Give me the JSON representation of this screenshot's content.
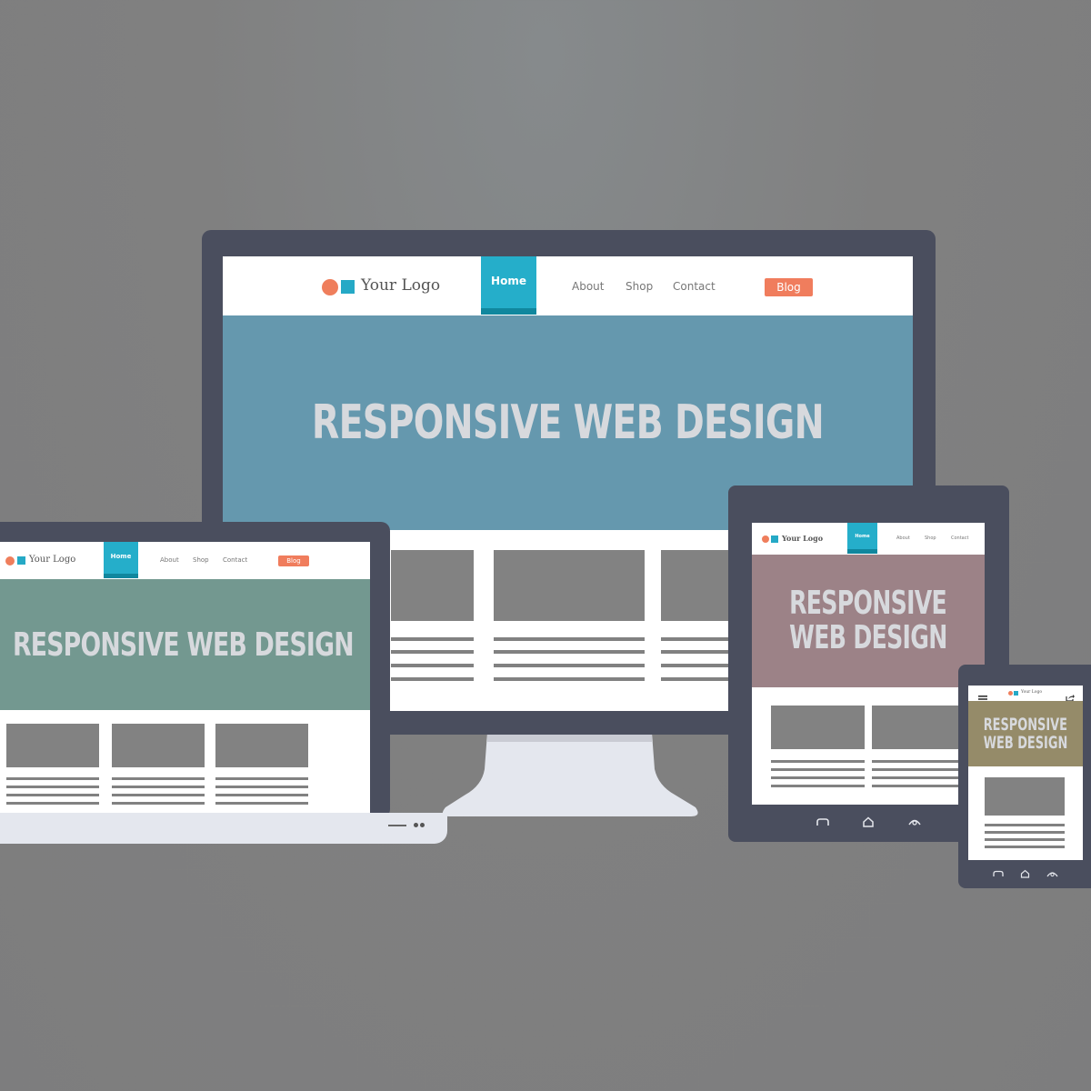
{
  "colors": {
    "bezel": "#4a4e5e",
    "accent_home": "#25aeca",
    "blog_button": "#f07d5d",
    "desktop_hero": "#6598ae",
    "laptop_hero": "#739890",
    "tablet_hero": "#9c8287",
    "phone_hero": "#958b69"
  },
  "desktop": {
    "logo_text": "Your Logo",
    "nav": {
      "home": "Home",
      "about": "About",
      "shop": "Shop",
      "contact": "Contact",
      "blog": "Blog"
    },
    "hero_title": "RESPONSIVE WEB DESIGN"
  },
  "laptop": {
    "logo_text": "Your Logo",
    "nav": {
      "home": "Home",
      "about": "About",
      "shop": "Shop",
      "contact": "Contact",
      "blog": "Blog"
    },
    "hero_title": "RESPONSIVE WEB DESIGN"
  },
  "tablet": {
    "logo_text": "Your Logo",
    "nav": {
      "home": "Home",
      "about": "About",
      "shop": "Shop",
      "contact": "Contact"
    },
    "hero_line1": "RESPONSIVE",
    "hero_line2": "WEB DESIGN",
    "buttons": [
      "back-icon",
      "home-icon",
      "recent-apps-icon"
    ]
  },
  "phone": {
    "logo_text": "Your Logo",
    "hero_line1": "RESPONSIVE",
    "hero_line2": "WEB DESIGN",
    "buttons": [
      "back-icon",
      "home-icon",
      "recent-apps-icon"
    ]
  }
}
